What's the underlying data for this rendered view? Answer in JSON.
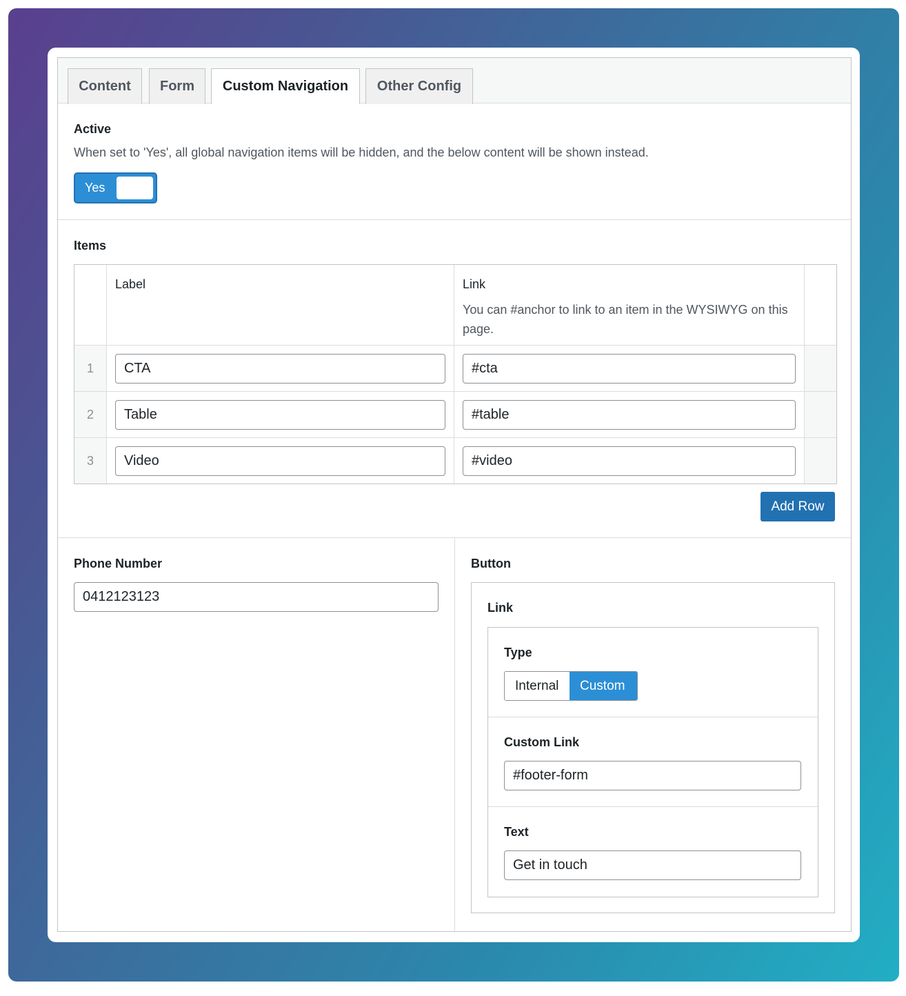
{
  "tabs": [
    {
      "label": "Content"
    },
    {
      "label": "Form"
    },
    {
      "label": "Custom Navigation"
    },
    {
      "label": "Other Config"
    }
  ],
  "active_field": {
    "label": "Active",
    "description": "When set to 'Yes', all global navigation items will be hidden, and the below content will be shown instead.",
    "toggle_label": "Yes",
    "value": true
  },
  "items": {
    "label": "Items",
    "columns": {
      "label": "Label",
      "link": "Link",
      "link_hint": "You can #anchor to link to an item in the WYSIWYG on this page."
    },
    "rows": [
      {
        "num": "1",
        "label": "CTA",
        "link": "#cta"
      },
      {
        "num": "2",
        "label": "Table",
        "link": "#table"
      },
      {
        "num": "3",
        "label": "Video",
        "link": "#video"
      }
    ],
    "add_row": "Add Row"
  },
  "phone": {
    "label": "Phone Number",
    "value": "0412123123"
  },
  "button": {
    "label": "Button",
    "link": {
      "label": "Link",
      "type": {
        "label": "Type",
        "options": [
          "Internal",
          "Custom"
        ],
        "selected": "Custom"
      },
      "custom_link": {
        "label": "Custom Link",
        "value": "#footer-form"
      },
      "text": {
        "label": "Text",
        "value": "Get in touch"
      }
    }
  },
  "colors": {
    "primary": "#2271b1",
    "toggle_on": "#2c8fd6",
    "border": "#c3c4c7"
  }
}
